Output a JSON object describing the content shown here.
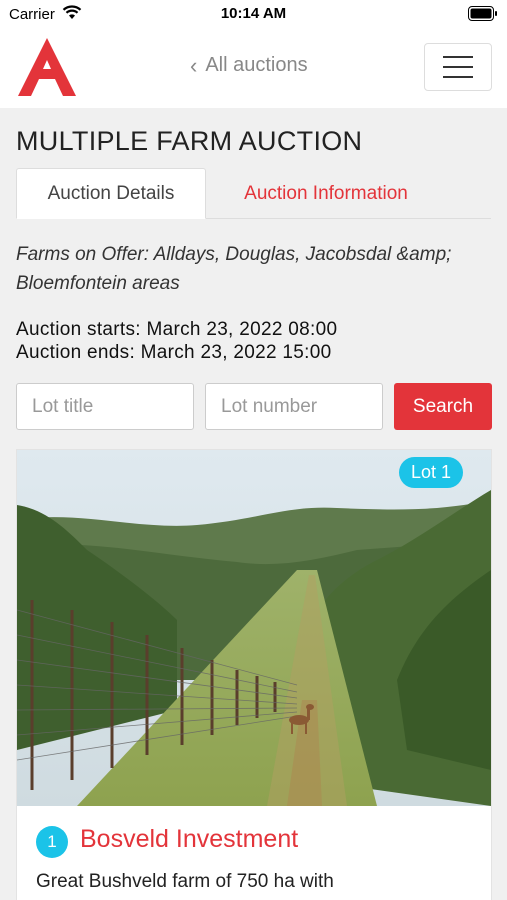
{
  "status_bar": {
    "carrier": "Carrier",
    "time": "10:14 AM"
  },
  "header": {
    "back_label": "All auctions",
    "logo_icon": "auction-a-logo",
    "menu_icon": "hamburger-menu-icon",
    "brand_color": "#e3343a"
  },
  "page": {
    "title": "MULTIPLE FARM AUCTION",
    "tabs": [
      {
        "label": "Auction Details",
        "active": true
      },
      {
        "label": "Auction Information",
        "active": false
      }
    ],
    "farms_on_offer": "Farms on Offer: Alldays, Douglas, Jacobsdal &amp; Bloemfontein areas",
    "auction_starts": "Auction starts: March 23, 2022 08:00",
    "auction_ends": "Auction ends: March 23, 2022 15:00"
  },
  "search": {
    "lot_title_placeholder": "Lot title",
    "lot_number_placeholder": "Lot number",
    "button_label": "Search"
  },
  "lots": [
    {
      "badge": "Lot 1",
      "number": "1",
      "name": "Bosveld Investment",
      "description": "Great Bushveld farm of 750 ha with",
      "image": "bushveld-fence-road-photo"
    }
  ],
  "colors": {
    "accent": "#e3343a",
    "badge": "#1bc3e8"
  }
}
